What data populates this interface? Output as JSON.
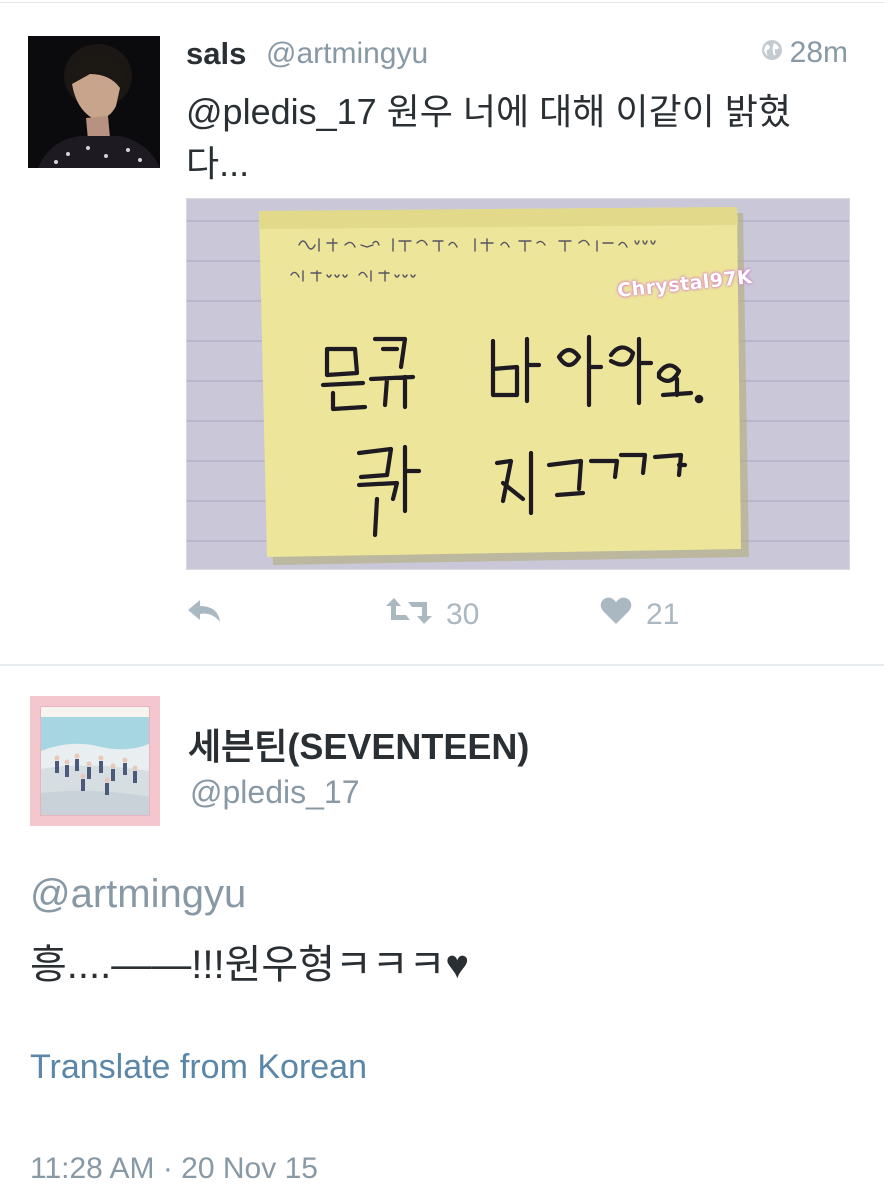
{
  "tweet1": {
    "author_name": "sals",
    "author_handle": "@artmingyu",
    "time_ago": "28m",
    "text": "@pledis_17 원우 너에 대해 이같이 밝혔다...",
    "media": {
      "watermark": "Chrystal97K"
    },
    "actions": {
      "retweets": "30",
      "likes": "21"
    }
  },
  "tweet2": {
    "author_name": "세븐틴(SEVENTEEN)",
    "author_handle": "@pledis_17",
    "mention": "@artmingyu",
    "text": "흥....——!!!원우형ㅋㅋㅋ♥",
    "translate_label": "Translate from Korean",
    "timestamp": "11:28 AM · 20 Nov 15"
  },
  "colors": {
    "text": "#292f33",
    "secondary": "#8899a6",
    "link": "#5a86a8",
    "action_icon": "#aab8c2",
    "sticky_note": "#ece59a",
    "avatar2_frame": "#f4c6ce"
  },
  "icons": {
    "globe": "globe-icon",
    "reply": "reply-icon",
    "retweet": "retweet-icon",
    "like": "heart-icon"
  }
}
